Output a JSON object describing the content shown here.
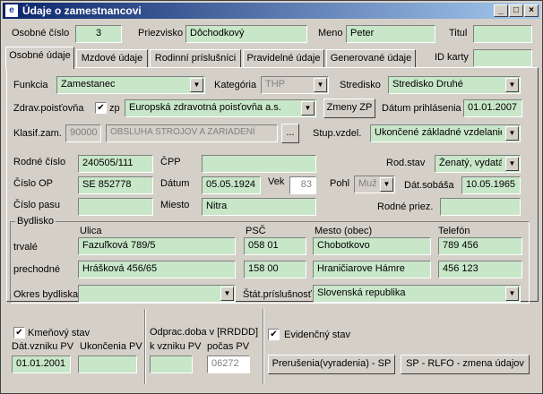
{
  "window": {
    "title": "Údaje o zamestnancovi",
    "app_icon": "e"
  },
  "header": {
    "osobne_cislo_label": "Osobné číslo",
    "osobne_cislo": "3",
    "priezvisko_label": "Priezvisko",
    "priezvisko": "Dôchodkový",
    "meno_label": "Meno",
    "meno": "Peter",
    "titul_label": "Titul",
    "titul": "",
    "id_karty_label": "ID karty",
    "id_karty": ""
  },
  "tabs": [
    {
      "label": "Osobné údaje"
    },
    {
      "label": "Mzdové údaje"
    },
    {
      "label": "Rodinní príslušníci"
    },
    {
      "label": "Pravidelné údaje"
    },
    {
      "label": "Generované údaje"
    }
  ],
  "work": {
    "funkcia_label": "Funkcia",
    "funkcia": "Zamestanec",
    "kategoria_label": "Kategória",
    "kategoria": "THP",
    "stredisko_label": "Stredisko",
    "stredisko": "Stredisko Druhé",
    "zdrav_label": "Zdrav.poisťovňa",
    "zp_label": "zp",
    "zp_checked": "✔",
    "zdrav": "Europská zdravotná poisťovňa a.s.",
    "zmeny_zp_button": "Zmeny ZP",
    "datum_prihl_label": "Dátum prihlásenia",
    "datum_prihl": "01.01.2007",
    "klasif_label": "Klasif.zam.",
    "klasif_code": "90000",
    "klasif_text": "OBSLUHA  STROJOV  A  ZARIADENÍ",
    "klasif_button": "...",
    "stup_vzdel_label": "Stup.vzdel.",
    "stup_vzdel": "Ukončené základné vzdelanie"
  },
  "personal": {
    "rodne_cislo_label": "Rodné číslo",
    "rodne_cislo": "240505/111",
    "cpp_label": "ČPP",
    "cpp": "",
    "rod_stav_label": "Rod.stav",
    "rod_stav": "Ženatý, vydatá",
    "cislo_op_label": "Číslo OP",
    "cislo_op": "SE 852778",
    "datum_label": "Dátum",
    "datum": "05.05.1924",
    "vek_label": "Vek",
    "vek": "83",
    "pohl_label": "Pohl",
    "pohl": "Mužsk",
    "dat_sobasa_label": "Dát.sobáša",
    "dat_sobasa": "10.05.1965",
    "cislo_pasu_label": "Číslo pasu",
    "cislo_pasu": "",
    "miesto_label": "Miesto",
    "miesto": "Nitra",
    "rodne_priez_label": "Rodné priez.",
    "rodne_priez": ""
  },
  "address": {
    "group_label": "Bydlisko",
    "ulica_label": "Ulica",
    "psc_label": "PSČ",
    "mesto_label": "Mesto (obec)",
    "telefon_label": "Telefón",
    "trvale_label": "trvalé",
    "trvale_ulica": "Fazuľková 789/5",
    "trvale_psc": "058 01",
    "trvale_mesto": "Chobotkovo",
    "trvale_telefon": "789 456",
    "prechodne_label": "prechodné",
    "prechodne_ulica": "Hrášková 456/65",
    "prechodne_psc": "158 00",
    "prechodne_mesto": "Hraničiarove Hámre",
    "prechodne_telefon": "456 123",
    "okres_label": "Okres bydliska",
    "okres": "",
    "stat_label": "Štát.príslušnosť",
    "stat": "Slovenská republika"
  },
  "bottom": {
    "kmenovy_label": "Kmeňový stav",
    "kmenovy_checked": "✔",
    "dat_vzniku_label": "Dát.vzniku PV",
    "dat_vzniku": "01.01.2001",
    "ukoncenia_label": "Ukončenia PV",
    "ukoncenia": "",
    "odprac_label": "Odprac.doba v [RRDDD]",
    "k_vzniku_label": "k vzniku PV",
    "k_vzniku": "",
    "pocas_label": "počas PV",
    "pocas": "06272",
    "evidencny_label": "Evidenčný stav",
    "evidencny_checked": "✔",
    "prerusenia_button": "Prerušenia(vyradenia) - SP",
    "sp_rlfo_button": "SP - RLFO - zmena údajov"
  }
}
